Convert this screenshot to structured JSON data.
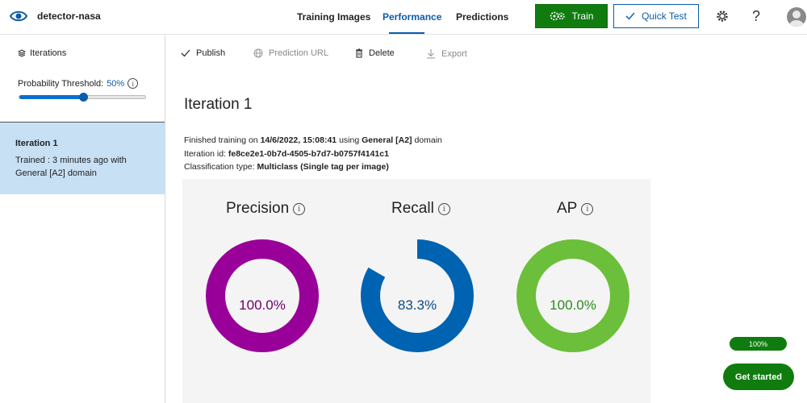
{
  "header": {
    "project_name": "detector-nasa",
    "tabs": [
      {
        "label": "Training Images"
      },
      {
        "label": "Performance"
      },
      {
        "label": "Predictions"
      }
    ],
    "active_tab": "Performance",
    "train_label": "Train",
    "quick_test_label": "Quick Test",
    "help_glyph": "?"
  },
  "sidebar": {
    "iterations_label": "Iterations",
    "threshold_label": "Probability Threshold:",
    "threshold_value": "50%",
    "threshold_level": 0.5,
    "iteration_card": {
      "title": "Iteration 1",
      "text": "Trained : 3 minutes ago with General [A2] domain"
    }
  },
  "toolbar": {
    "publish": "Publish",
    "prediction_url": "Prediction URL",
    "delete": "Delete",
    "export": "Export"
  },
  "main": {
    "title": "Iteration 1",
    "training_prefix": "Finished training on",
    "training_date": "14/6/2022, 15:08:41",
    "training_middle": "using",
    "training_domain": "General [A2]",
    "training_suffix": "domain",
    "iteration_id_label": "Iteration id:",
    "iteration_id": "fe8ce2e1-0b7d-4505-b7d7-b0757f4141c1",
    "classification_label": "Classification type:",
    "classification_value": "Multiclass (Single tag per image)"
  },
  "metrics": [
    {
      "name": "Precision",
      "value": 100.0,
      "display": "100.0%",
      "color": "#990099",
      "text_color": "#6b006b"
    },
    {
      "name": "Recall",
      "value": 83.3,
      "display": "83.3%",
      "color": "#0063b1",
      "text_color": "#0b4a8a"
    },
    {
      "name": "AP",
      "value": 100.0,
      "display": "100.0%",
      "color": "#6bbf3a",
      "text_color": "#2e8a1e"
    }
  ],
  "footer": {
    "progress": "100%",
    "get_started": "Get started"
  },
  "colors": {
    "accent": "#0b5cab",
    "train_green": "#107c10",
    "selected_row": "#c7e0f4"
  },
  "icons": [
    "eye-icon",
    "gears-icon",
    "checkmark-icon",
    "gear-icon",
    "help-icon",
    "avatar",
    "layers-icon",
    "info-icon",
    "globe-icon",
    "trash-icon",
    "download-icon"
  ]
}
